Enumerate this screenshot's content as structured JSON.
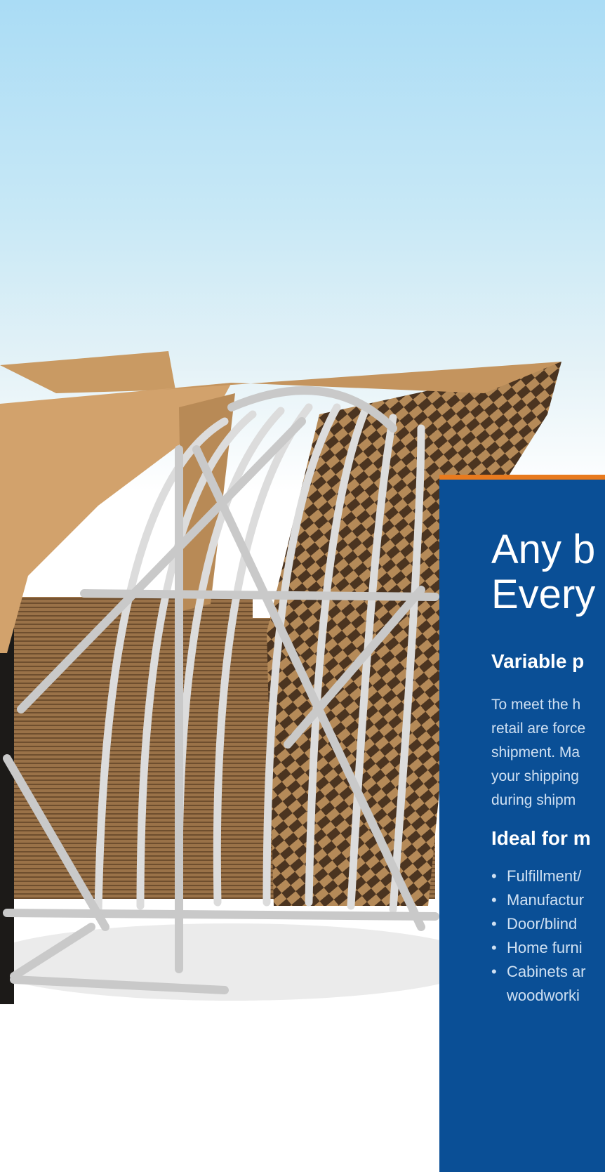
{
  "panel": {
    "accent_color": "#e87a1e",
    "background_color": "#0a4f96",
    "headline_lines": [
      "Any b",
      "Every"
    ],
    "section1_title": "Variable p",
    "body_lines": [
      "To meet the h",
      "retail are force",
      "shipment. Ma",
      "your shipping",
      "during shipm"
    ],
    "section2_title": "Ideal for m",
    "bullets": [
      {
        "bullet": "•",
        "text": "Fulfillment/"
      },
      {
        "bullet": "•",
        "text": "Manufactur"
      },
      {
        "bullet": "•",
        "text": "Door/blind"
      },
      {
        "bullet": "•",
        "text": "Home furni"
      },
      {
        "bullet": "•",
        "text": "Cabinets ar"
      }
    ],
    "bullet_continuation": "woodworki"
  }
}
